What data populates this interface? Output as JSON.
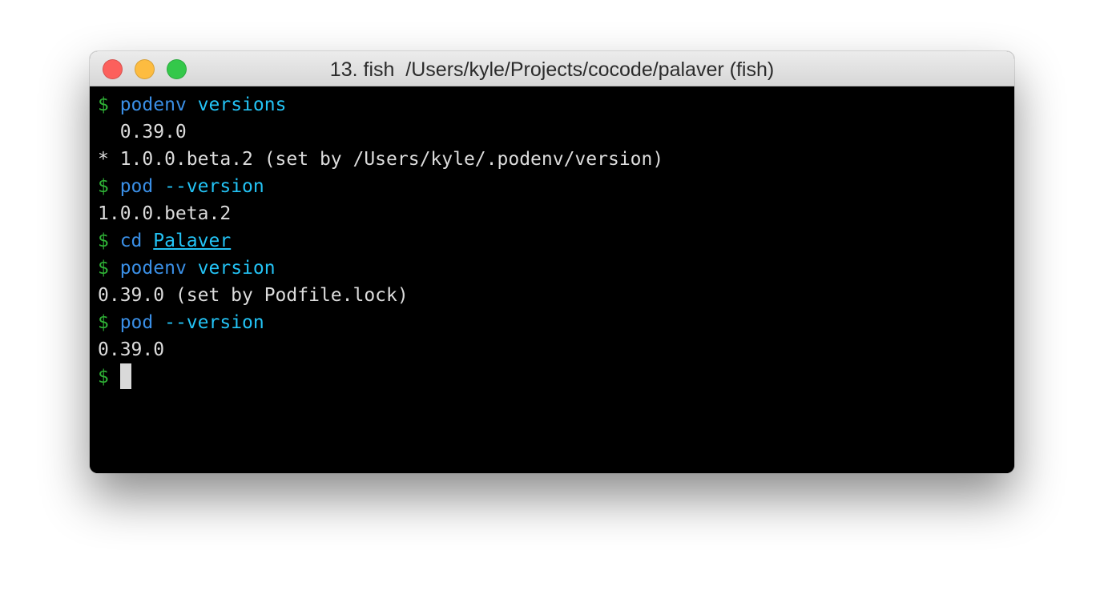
{
  "window": {
    "title": "13. fish  /Users/kyle/Projects/cocode/palaver (fish)"
  },
  "colors": {
    "prompt": "#2fb236",
    "command": "#3a8fe6",
    "argument": "#23c3f5",
    "output": "#dcdcdc",
    "light_close": "#fc605c",
    "light_minimize": "#fdbc40",
    "light_zoom": "#34c84a"
  },
  "terminal": {
    "lines": [
      [
        {
          "text": "$ ",
          "role": "prompt"
        },
        {
          "text": "podenv",
          "role": "command"
        },
        {
          "text": " ",
          "role": "output"
        },
        {
          "text": "versions",
          "role": "argument"
        }
      ],
      [
        {
          "text": "  0.39.0",
          "role": "output"
        }
      ],
      [
        {
          "text": "* 1.0.0.beta.2 (set by /Users/kyle/.podenv/version)",
          "role": "output"
        }
      ],
      [
        {
          "text": "$ ",
          "role": "prompt"
        },
        {
          "text": "pod",
          "role": "command"
        },
        {
          "text": " ",
          "role": "output"
        },
        {
          "text": "--version",
          "role": "argument"
        }
      ],
      [
        {
          "text": "1.0.0.beta.2",
          "role": "output"
        }
      ],
      [
        {
          "text": "$ ",
          "role": "prompt"
        },
        {
          "text": "cd",
          "role": "command"
        },
        {
          "text": " ",
          "role": "output"
        },
        {
          "text": "Palaver",
          "role": "path"
        }
      ],
      [
        {
          "text": "$ ",
          "role": "prompt"
        },
        {
          "text": "podenv",
          "role": "command"
        },
        {
          "text": " ",
          "role": "output"
        },
        {
          "text": "version",
          "role": "argument"
        }
      ],
      [
        {
          "text": "0.39.0 (set by Podfile.lock)",
          "role": "output"
        }
      ],
      [
        {
          "text": "$ ",
          "role": "prompt"
        },
        {
          "text": "pod",
          "role": "command"
        },
        {
          "text": " ",
          "role": "output"
        },
        {
          "text": "--version",
          "role": "argument"
        }
      ],
      [
        {
          "text": "0.39.0",
          "role": "output"
        }
      ],
      [
        {
          "text": "$ ",
          "role": "prompt"
        },
        {
          "text": "",
          "role": "cursor"
        }
      ]
    ]
  }
}
